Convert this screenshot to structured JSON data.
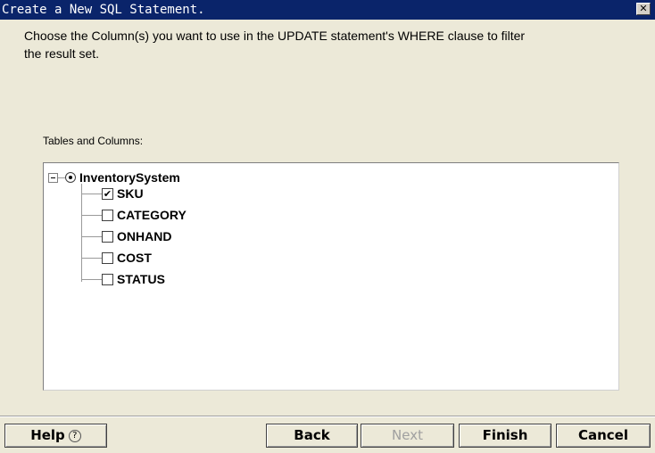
{
  "window": {
    "title": "Create a New SQL Statement.",
    "close_glyph": "✕"
  },
  "instructions": {
    "line1": "Choose the Column(s) you want to use in the UPDATE statement's WHERE clause to filter",
    "line2": "the result set."
  },
  "tree": {
    "label": "Tables and Columns:",
    "root": {
      "label": "InventorySystem",
      "selected": true
    },
    "columns": [
      {
        "label": "SKU",
        "checked": true
      },
      {
        "label": "CATEGORY",
        "checked": false
      },
      {
        "label": "ONHAND",
        "checked": false
      },
      {
        "label": "COST",
        "checked": false
      },
      {
        "label": "STATUS",
        "checked": false
      }
    ]
  },
  "buttons": {
    "help": "Help",
    "help_icon": "?",
    "back": "Back",
    "next": "Next",
    "finish": "Finish",
    "cancel": "Cancel"
  }
}
